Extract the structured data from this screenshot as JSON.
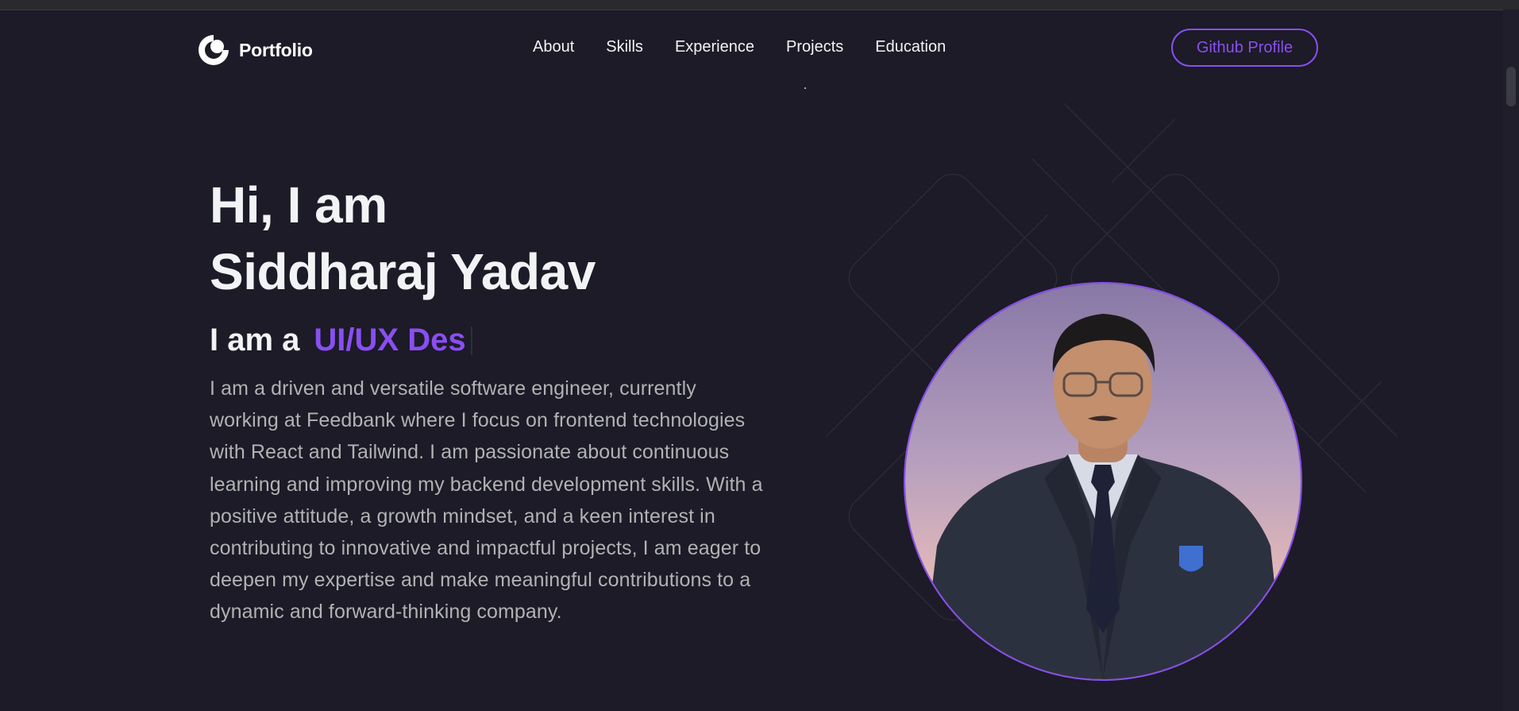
{
  "nav": {
    "brand": "Portfolio",
    "links": [
      "About",
      "Skills",
      "Experience",
      "Projects",
      "Education"
    ],
    "github_button": "Github Profile"
  },
  "hero": {
    "greeting": "Hi, I am",
    "name": "Siddharaj Yadav",
    "role_prefix": "I am a",
    "role_typed": "UI/UX Des",
    "description": "I am a driven and versatile software engineer, currently working at Feedbank where I focus on frontend technologies with React and Tailwind. I am passionate about continuous learning and improving my backend development skills. With a positive attitude, a growth mindset, and a keen interest in contributing to innovative and impactful projects, I am eager to deepen my expertise and make meaningful contributions to a dynamic and forward-thinking company."
  },
  "profile_photo": {
    "subject": "person-portrait"
  },
  "colors": {
    "background": "#1c1b27",
    "accent": "#8a4ef2",
    "heading": "#f2f3f5",
    "body_text": "#b1b2b3"
  },
  "icons": {
    "brand_logo": "circle-logo-icon"
  }
}
